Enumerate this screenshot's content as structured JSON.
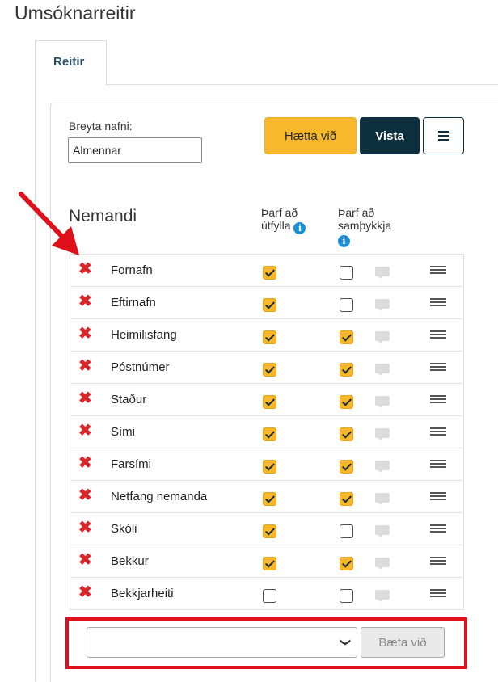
{
  "page": {
    "title": "Umsóknarreitir"
  },
  "tabs": [
    {
      "label": "Reitir"
    }
  ],
  "rename": {
    "label": "Breyta nafni:",
    "value": "Almennar"
  },
  "toolbar": {
    "cancel_label": "Hætta við",
    "save_label": "Vista",
    "menu_icon": "hamburger-icon"
  },
  "section": {
    "title": "Nemandi",
    "col_required": "Þarf að útfylla",
    "col_approve": "Þarf að samþykkja"
  },
  "fields": [
    {
      "name": "Fornafn",
      "required": true,
      "approve": false
    },
    {
      "name": "Eftirnafn",
      "required": true,
      "approve": false
    },
    {
      "name": "Heimilisfang",
      "required": true,
      "approve": true
    },
    {
      "name": "Póstnúmer",
      "required": true,
      "approve": true
    },
    {
      "name": "Staður",
      "required": true,
      "approve": true
    },
    {
      "name": "Sími",
      "required": true,
      "approve": true
    },
    {
      "name": "Farsími",
      "required": true,
      "approve": true
    },
    {
      "name": "Netfang nemanda",
      "required": true,
      "approve": true
    },
    {
      "name": "Skóli",
      "required": true,
      "approve": false
    },
    {
      "name": "Bekkur",
      "required": true,
      "approve": true
    },
    {
      "name": "Bekkjarheiti",
      "required": false,
      "approve": false
    }
  ],
  "add": {
    "selected": "",
    "button_label": "Bæta við"
  },
  "annotations": {
    "arrow_color": "#e0101a",
    "highlight_color": "#e0101a"
  },
  "colors": {
    "accent": "#f9b72b",
    "primary": "#0e2f3d",
    "remove": "#d9262b",
    "info": "#1a8fd8"
  }
}
